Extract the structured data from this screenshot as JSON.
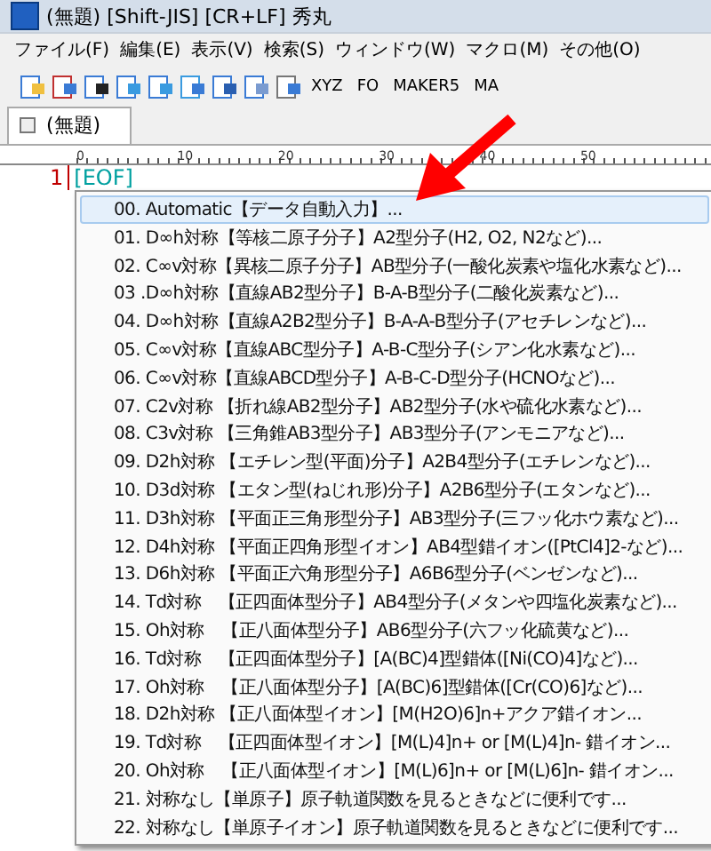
{
  "window": {
    "title": "(無題) [Shift-JIS] [CR+LF] 秀丸"
  },
  "menu": [
    "ファイル(F)",
    "編集(E)",
    "表示(V)",
    "検索(S)",
    "ウィンドウ(W)",
    "マクロ(M)",
    "その他(O)"
  ],
  "toolbar_texts": [
    "XYZ",
    "FO",
    "MAKER5",
    "MA"
  ],
  "tabs": [
    {
      "label": "(無題)",
      "selected": true
    }
  ],
  "ruler": [
    "0",
    "10",
    "20",
    "30",
    "40",
    "50"
  ],
  "editor": {
    "line_number": "1",
    "eof": "[EOF]"
  },
  "popup_items": [
    {
      "label": "00. Automatic【データ自動入力】...",
      "selected": true
    },
    {
      "label": "01. D∞h対称【等核二原子分子】A2型分子(H2, O2, N2など)...",
      "selected": false
    },
    {
      "label": "02. C∞v対称【異核二原子分子】AB型分子(一酸化炭素や塩化水素など)...",
      "selected": false
    },
    {
      "label": "03 .D∞h対称【直線AB2型分子】B-A-B型分子(二酸化炭素など)...",
      "selected": false
    },
    {
      "label": "04. D∞h対称【直線A2B2型分子】B-A-A-B型分子(アセチレンなど)...",
      "selected": false
    },
    {
      "label": "05. C∞v対称【直線ABC型分子】A-B-C型分子(シアン化水素など)...",
      "selected": false
    },
    {
      "label": "06. C∞v対称【直線ABCD型分子】A-B-C-D型分子(HCNOなど)...",
      "selected": false
    },
    {
      "label": "07. C2v対称 【折れ線AB2型分子】AB2型分子(水や硫化水素など)...",
      "selected": false
    },
    {
      "label": "08. C3v対称 【三角錐AB3型分子】AB3型分子(アンモニアなど)...",
      "selected": false
    },
    {
      "label": "09. D2h対称 【エチレン型(平面)分子】A2B4型分子(エチレンなど)...",
      "selected": false
    },
    {
      "label": "10. D3d対称 【エタン型(ねじれ形)分子】A2B6型分子(エタンなど)...",
      "selected": false
    },
    {
      "label": "11. D3h対称 【平面正三角形型分子】AB3型分子(三フッ化ホウ素など)...",
      "selected": false
    },
    {
      "label": "12. D4h対称 【平面正四角形型イオン】AB4型錯イオン([PtCl4]2-など)...",
      "selected": false
    },
    {
      "label": "13. D6h対称 【平面正六角形型分子】A6B6型分子(ベンゼンなど)...",
      "selected": false
    },
    {
      "label": "14. Td対称　【正四面体型分子】AB4型分子(メタンや四塩化炭素など)...",
      "selected": false
    },
    {
      "label": "15. Oh対称　【正八面体型分子】AB6型分子(六フッ化硫黄など)...",
      "selected": false
    },
    {
      "label": "16. Td対称　【正四面体型分子】[A(BC)4]型錯体([Ni(CO)4]など)...",
      "selected": false
    },
    {
      "label": "17. Oh対称　【正八面体型分子】[A(BC)6]型錯体([Cr(CO)6]など)...",
      "selected": false
    },
    {
      "label": "18. D2h対称 【正八面体型イオン】[M(H2O)6]n+アクア錯イオン...",
      "selected": false
    },
    {
      "label": "19. Td対称　【正四面体型イオン】[M(L)4]n+ or [M(L)4]n- 錯イオン...",
      "selected": false
    },
    {
      "label": "20. Oh対称　【正八面体型イオン】[M(L)6]n+ or [M(L)6]n- 錯イオン...",
      "selected": false
    },
    {
      "label": "21. 対称なし【単原子】原子軌道関数を見るときなどに便利です...",
      "selected": false
    },
    {
      "label": "22. 対称なし【単原子イオン】原子軌道関数を見るときなどに便利です...",
      "selected": false
    }
  ]
}
